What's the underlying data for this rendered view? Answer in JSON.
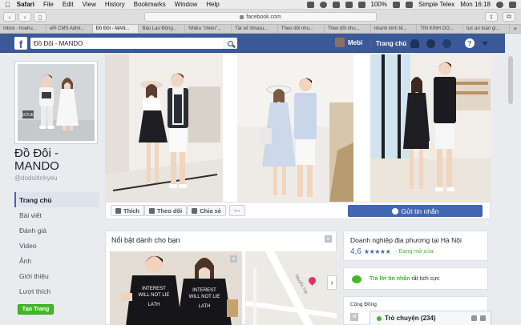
{
  "menubar": {
    "app": "Safari",
    "items": [
      "File",
      "Edit",
      "View",
      "History",
      "Bookmarks",
      "Window",
      "Help"
    ],
    "battery": "100%",
    "user": "Simple Telex",
    "clock": "Mon 16:18"
  },
  "toolbar": {
    "url": "facebook.com"
  },
  "tabs": [
    "Inbox - hoahu...",
    "ePi CMS Admi...",
    "Đồ Đôi - MAN...",
    "Báo Lao Động...",
    "Nhiều \"chiêu\"...",
    "Tài xế Vinasu...",
    "Theo dõi nhu...",
    "Theo dõi nhu...",
    "nhanh kinh tế...",
    "TIN KINH DO...",
    "lực an toàn gi..."
  ],
  "facebook": {
    "search_value": "Đồ Đôi - MANDO",
    "user_name": "Mebi",
    "home_label": "Trang chủ"
  },
  "page": {
    "name": "Đồ Đôi - MANDO",
    "handle": "@dodoitinhyeu",
    "nav": [
      {
        "label": "Trang chủ",
        "active": true
      },
      {
        "label": "Bài viết"
      },
      {
        "label": "Đánh giá"
      },
      {
        "label": "Video"
      },
      {
        "label": "Ảnh"
      },
      {
        "label": "Giới thiệu"
      },
      {
        "label": "Lượt thích"
      }
    ],
    "create_page_label": "Tạo Trang"
  },
  "actions": {
    "like": "Thích",
    "follow": "Theo dõi",
    "share": "Chia sẻ",
    "more": "···",
    "send_message": "Gửi tin nhắn"
  },
  "featured": {
    "title": "Nổi bật dành cho bạn",
    "close": "×",
    "map_label": "Nguyễn Trãi",
    "next": "›"
  },
  "sidebar_right": {
    "business_title": "Doanh nghiệp địa phương tại Hà Nội",
    "rating": "4,6",
    "stars": "★★★★★",
    "open_status": "· Đang mở cửa",
    "reply_prefix": "Trả lời tin nhắn",
    "reply_suffix": " rất tích cực",
    "community_title": "Cộng Đồng",
    "community_icon": "M"
  },
  "chat": {
    "label": "Trò chuyện (234)"
  },
  "colors": {
    "fb_blue": "#3b5998",
    "button_blue": "#4267b2",
    "green": "#42b72a"
  }
}
